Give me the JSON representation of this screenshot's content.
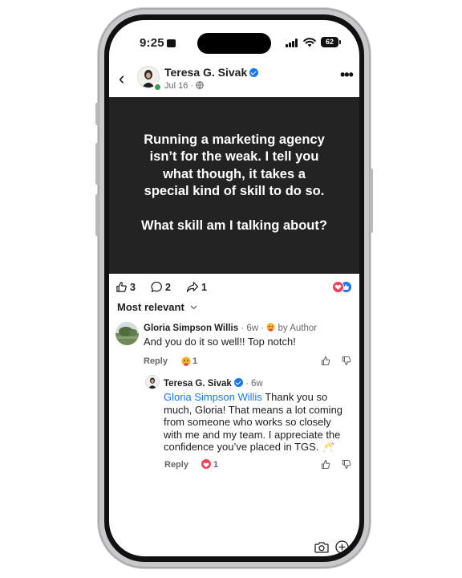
{
  "status_bar": {
    "time": "9:25",
    "battery": "62"
  },
  "post": {
    "author": "Teresa G. Sivak",
    "date": "Jul 16 ·",
    "lines": [
      "Running a marketing agency",
      "isn’t for the weak. I tell you",
      "what though, it takes a",
      "special kind of skill to do so.",
      "",
      "What skill am I talking about?"
    ],
    "like_count": "3",
    "comment_count": "2",
    "share_count": "1"
  },
  "comments_sort": "Most relevant",
  "comment1": {
    "author": "Gloria Simpson Willis",
    "age": "· 6w ·",
    "by_author": "by Author",
    "text_lines": [
      "And you do it so well!! Top notch!"
    ],
    "reply_label": "Reply",
    "reaction_count": "1"
  },
  "reply1": {
    "author": "Teresa G. Sivak",
    "age": "· 6w",
    "mention": "Gloria Simpson Willis",
    "line1_rest": " Thank you so",
    "text_lines": [
      "much, Gloria! That means a lot coming",
      "from someone who works so closely",
      "with me and my team. I appreciate the",
      "confidence you’ve placed in TGS. 🥂"
    ],
    "reply_label": "Reply",
    "reaction_count": "1"
  },
  "colors": {
    "brand_blue": "#1877f2",
    "post_bg": "#232323",
    "meta_gray": "#65676b",
    "love_red": "#f33e58"
  }
}
